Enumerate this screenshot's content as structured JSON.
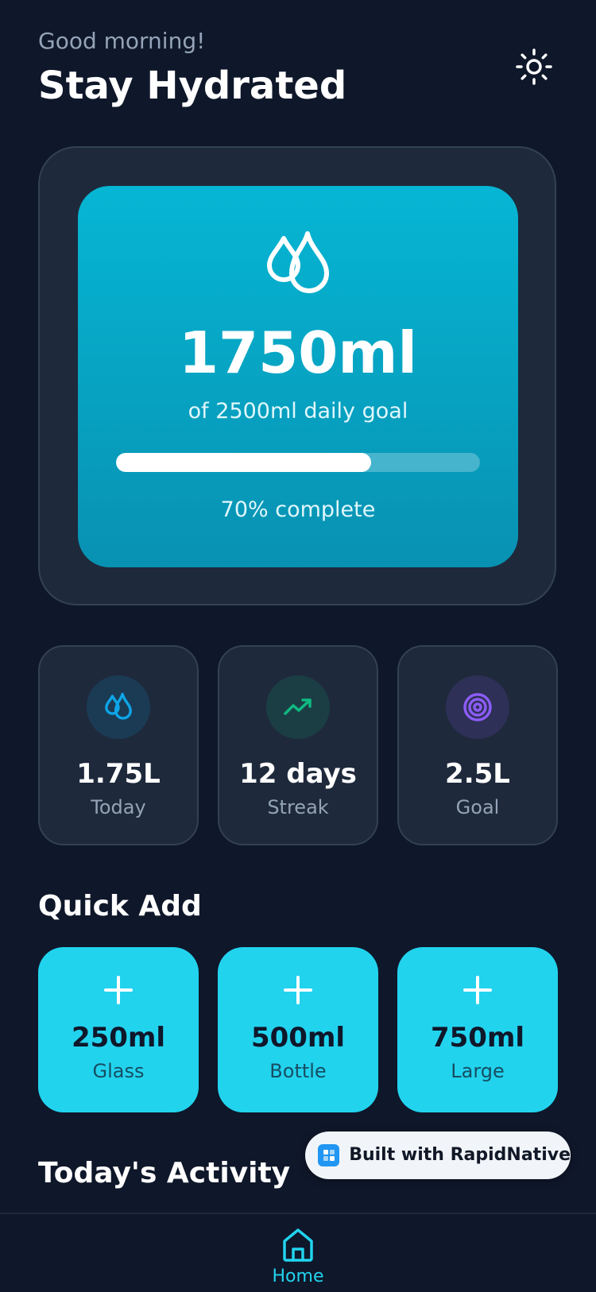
{
  "header": {
    "greeting": "Good morning!",
    "title": "Stay Hydrated"
  },
  "hero": {
    "amount": "1750ml",
    "goal_text": "of 2500ml daily goal",
    "progress_fraction": 0.7,
    "percent_text": "70% complete"
  },
  "stats": [
    {
      "value": "1.75L",
      "label": "Today",
      "icon": "water-drops-icon",
      "color": "#0ea5e9"
    },
    {
      "value": "12 days",
      "label": "Streak",
      "icon": "trending-up-icon",
      "color": "#10b981"
    },
    {
      "value": "2.5L",
      "label": "Goal",
      "icon": "target-icon",
      "color": "#8b5cf6"
    }
  ],
  "quick_add": {
    "title": "Quick Add",
    "items": [
      {
        "amount": "250ml",
        "label": "Glass"
      },
      {
        "amount": "500ml",
        "label": "Bottle"
      },
      {
        "amount": "750ml",
        "label": "Large"
      }
    ]
  },
  "activity": {
    "title": "Today's Activity"
  },
  "badge": {
    "text": "Built with RapidNative"
  },
  "nav": {
    "home_label": "Home"
  },
  "colors": {
    "background": "#0f172a",
    "card": "#1e293b",
    "accent": "#22d3ee",
    "hero_top": "#06b6d4",
    "hero_bottom": "#0891b2"
  }
}
